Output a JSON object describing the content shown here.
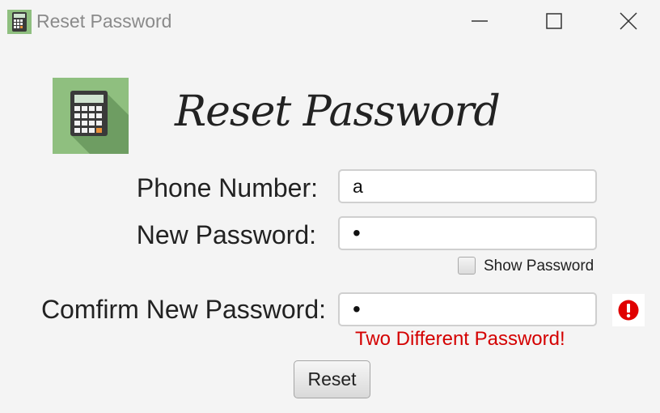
{
  "window": {
    "title": "Reset Password",
    "controls": {
      "minimize": "minimize-icon",
      "maximize": "maximize-icon",
      "close": "close-icon"
    }
  },
  "header": {
    "logo": "calculator-icon",
    "title": "Reset Password"
  },
  "form": {
    "phone": {
      "label": "Phone Number:",
      "value": "a"
    },
    "new_password": {
      "label": "New Password:",
      "value": "•"
    },
    "show_password": {
      "label": "Show Password",
      "checked": false
    },
    "confirm_password": {
      "label": "Comfirm New Password:",
      "value": "•"
    },
    "error": {
      "icon": "error-icon",
      "message": "Two Different Password!"
    },
    "reset_label": "Reset"
  },
  "colors": {
    "background": "#f4f4f4",
    "logo_background": "#8fbf7f",
    "error": "#d40000"
  }
}
